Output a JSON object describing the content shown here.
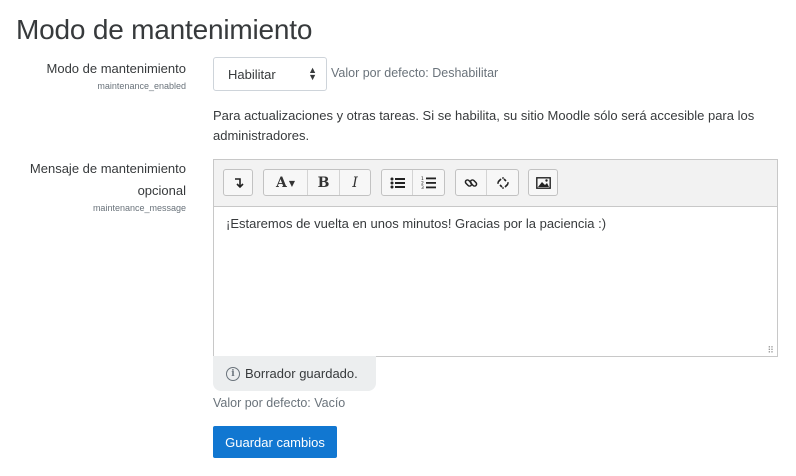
{
  "page": {
    "title": "Modo de mantenimiento"
  },
  "maintenance_enabled": {
    "label": "Modo de mantenimiento",
    "setting_name": "maintenance_enabled",
    "selected": "Habilitar",
    "default_text": "Valor por defecto: Deshabilitar",
    "description": "Para actualizaciones y otras tareas. Si se habilita, su sitio Moodle sólo será accesible para los administradores."
  },
  "maintenance_message": {
    "label_line1": "Mensaje de mantenimiento",
    "label_line2": "opcional",
    "setting_name": "maintenance_message",
    "toolbar": {
      "groups": [
        {
          "name": "collapse",
          "buttons": [
            "collapse-icon"
          ]
        },
        {
          "name": "style",
          "buttons": [
            "paragraph-styles-icon",
            "bold-icon",
            "italic-icon"
          ]
        },
        {
          "name": "list",
          "buttons": [
            "unordered-list-icon",
            "ordered-list-icon"
          ]
        },
        {
          "name": "links",
          "buttons": [
            "link-icon",
            "unlink-icon"
          ]
        },
        {
          "name": "files",
          "buttons": [
            "image-icon"
          ]
        }
      ],
      "bold_glyph": "B",
      "italic_glyph": "I",
      "style_glyph": "A"
    },
    "content": "¡Estaremos de vuelta en unos minutos! Gracias por la paciencia :)",
    "draft_status": "Borrador guardado.",
    "default_text": "Valor por defecto: Vacío"
  },
  "actions": {
    "save_label": "Guardar cambios"
  },
  "colors": {
    "primary_button": "#1177d1",
    "muted_text": "#6a737b",
    "toolbar_bg": "#f2f2f2",
    "draft_bg": "#eceeef"
  }
}
